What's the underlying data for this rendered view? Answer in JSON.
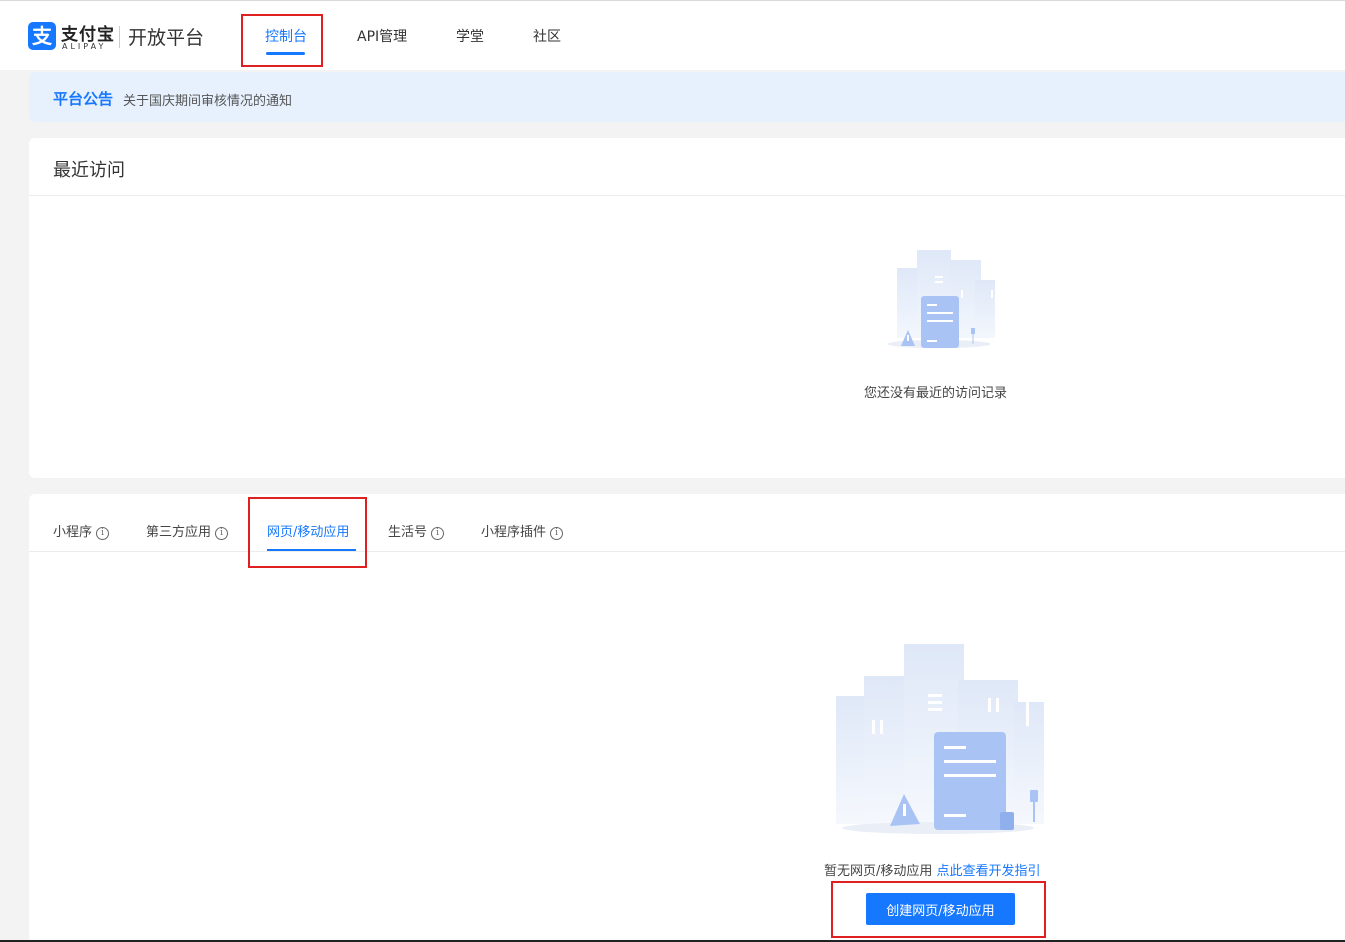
{
  "header": {
    "logo_cn": "支付宝",
    "logo_en": "ALIPAY",
    "platform_name": "开放平台",
    "nav": [
      {
        "label": "控制台",
        "active": true
      },
      {
        "label": "API管理",
        "active": false
      },
      {
        "label": "学堂",
        "active": false
      },
      {
        "label": "社区",
        "active": false
      }
    ]
  },
  "notice": {
    "title": "平台公告",
    "text": "关于国庆期间审核情况的通知"
  },
  "recent": {
    "title": "最近访问",
    "empty_text": "您还没有最近的访问记录"
  },
  "apps": {
    "tabs": [
      {
        "label": "小程序",
        "info": "i"
      },
      {
        "label": "第三方应用",
        "info": "i"
      },
      {
        "label": "网页/移动应用",
        "active": true
      },
      {
        "label": "生活号",
        "info": "i"
      },
      {
        "label": "小程序插件",
        "info": "i"
      }
    ],
    "empty_text": "暂无网页/移动应用",
    "guide_link": "点此查看开发指引",
    "create_button": "创建网页/移动应用"
  },
  "colors": {
    "accent": "#1677ff",
    "highlight_box": "#e02020",
    "notice_bg": "#e7f1fd"
  }
}
